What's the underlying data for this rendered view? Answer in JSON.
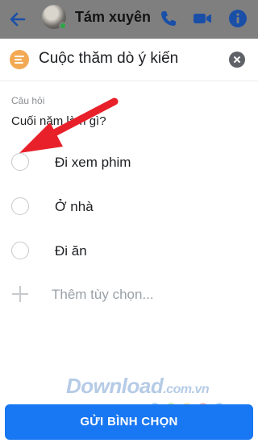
{
  "chat": {
    "contact_name": "Tám xuyên",
    "icons": [
      "back-arrow-icon",
      "phone-icon",
      "video-camera-icon",
      "info-icon"
    ]
  },
  "poll": {
    "title": "Cuộc thăm dò ý kiến",
    "question_label": "Câu hỏi",
    "question_value": "Cuối năm làm gì?",
    "options": [
      {
        "label": "Đi xem phim"
      },
      {
        "label": "Ở nhà"
      },
      {
        "label": "Đi ăn"
      }
    ],
    "add_option_placeholder": "Thêm tùy chọn...",
    "submit_label": "GỬI BÌNH CHỌN"
  },
  "watermark": {
    "brand": "Download",
    "domain": ".com.vn"
  },
  "colors": {
    "accent": "#1877f2",
    "poll_icon": "#f3a953",
    "annotation_arrow": "#e8202a"
  }
}
